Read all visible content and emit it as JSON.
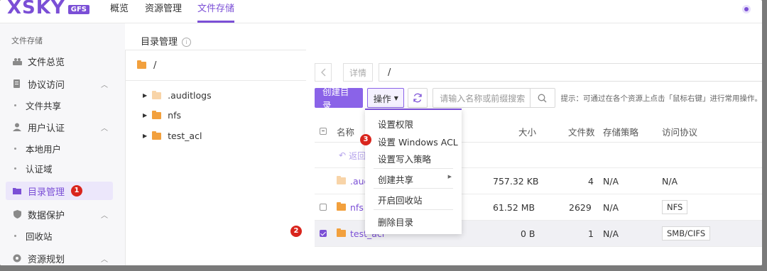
{
  "brand": {
    "name": "XSKY",
    "suffix": "GFS"
  },
  "nav": [
    {
      "label": "概览"
    },
    {
      "label": "资源管理"
    },
    {
      "label": "文件存储"
    }
  ],
  "sidebar": {
    "section": "文件存储",
    "items": [
      {
        "label": "文件总览"
      },
      {
        "label": "协议访问"
      },
      {
        "label": "文件共享"
      },
      {
        "label": "用户认证"
      },
      {
        "label": "本地用户"
      },
      {
        "label": "认证域"
      },
      {
        "label": "目录管理"
      },
      {
        "label": "数据保护"
      },
      {
        "label": "回收站"
      },
      {
        "label": "资源规划"
      }
    ]
  },
  "page_title": "目录管理",
  "tree": {
    "root": "/",
    "nodes": [
      {
        "label": ".auditlogs"
      },
      {
        "label": "nfs"
      },
      {
        "label": "test_acl"
      }
    ]
  },
  "pathbar": {
    "detail": "详情",
    "path": "/"
  },
  "toolbar": {
    "create": "创建目录",
    "ops": "操作",
    "search_placeholder": "请输入名称或前缀搜索",
    "hint": "提示：可通过在各个资源上点击「鼠标右键」进行常用操作。"
  },
  "table": {
    "headers": {
      "name": "名称",
      "size": "大小",
      "files": "文件数",
      "policy": "存储策略",
      "protocol": "访问协议"
    },
    "back": "返回",
    "rows": [
      {
        "name": ".aud",
        "size": "757.32 KB",
        "files": "4",
        "policy": "N/A",
        "protocol": "N/A"
      },
      {
        "name": "nfs",
        "size": "61.52 MB",
        "files": "2629",
        "policy": "N/A",
        "protocol": "NFS"
      },
      {
        "name": "test_acl",
        "size": "0 B",
        "files": "1",
        "policy": "N/A",
        "protocol": "SMB/CIFS"
      }
    ]
  },
  "menu": [
    {
      "label": "设置权限"
    },
    {
      "label": "设置 Windows ACL"
    },
    {
      "label": "设置写入策略"
    },
    {
      "label": "创建共享"
    },
    {
      "label": "开启回收站"
    },
    {
      "label": "删除目录"
    }
  ],
  "badges": [
    "1",
    "2",
    "3"
  ],
  "colors": {
    "accent": "#7b4fd6",
    "folder": "#f2a03d",
    "badge": "#d9251d"
  }
}
